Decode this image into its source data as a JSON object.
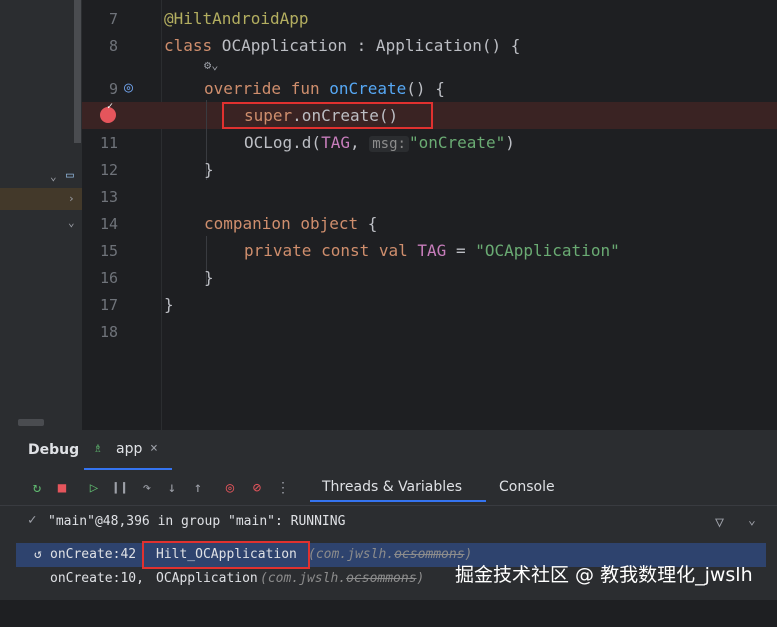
{
  "editor": {
    "line_numbers": [
      "7",
      "8",
      "9",
      "10",
      "11",
      "12",
      "13",
      "14",
      "15",
      "16",
      "17",
      "18"
    ],
    "lines": {
      "l7_annotation": "@HiltAndroidApp",
      "l8_kw": "class",
      "l8_rest": " OCApplication : Application() {",
      "l9_kw": "override fun",
      "l9_fn": "onCreate",
      "l9_rest": "() {",
      "l10_kw": "super",
      "l10_rest": ".onCreate()",
      "l11_pre": "OCLog.d(",
      "l11_tag": "TAG",
      "l11_mid": ", ",
      "l11_hint": "msg:",
      "l11_str": "\"onCreate\"",
      "l11_end": ")",
      "l12": "}",
      "l14_kw": "companion object",
      "l14_rest": " {",
      "l15_kw": "private const val",
      "l15_const": "TAG",
      "l15_eq": " = ",
      "l15_str": "\"OCApplication\"",
      "l16": "}",
      "l17": "}"
    }
  },
  "debug": {
    "title": "Debug",
    "tab_label": "app",
    "close": "×",
    "subtabs": [
      "Threads & Variables",
      "Console"
    ],
    "thread_status": "\"main\"@48,396 in group \"main\": RUNNING",
    "frames": [
      {
        "method": "onCreate:42",
        "class": "Hilt_OCApplication",
        "pkg_prefix": "(com.jwslh.",
        "pkg_redacted": "ocsommons",
        "pkg_suffix": ")"
      },
      {
        "method": "onCreate:10,",
        "class": "OCApplication",
        "pkg_prefix": "(com.jwslh.",
        "pkg_redacted": "ocsommons",
        "pkg_suffix": ")"
      }
    ]
  },
  "watermark": "掘金技术社区 @ 教我数理化_jwslh",
  "colors": {
    "accent": "#3574f0",
    "highlight": "#e0312f",
    "breakpoint": "#e5555c"
  }
}
